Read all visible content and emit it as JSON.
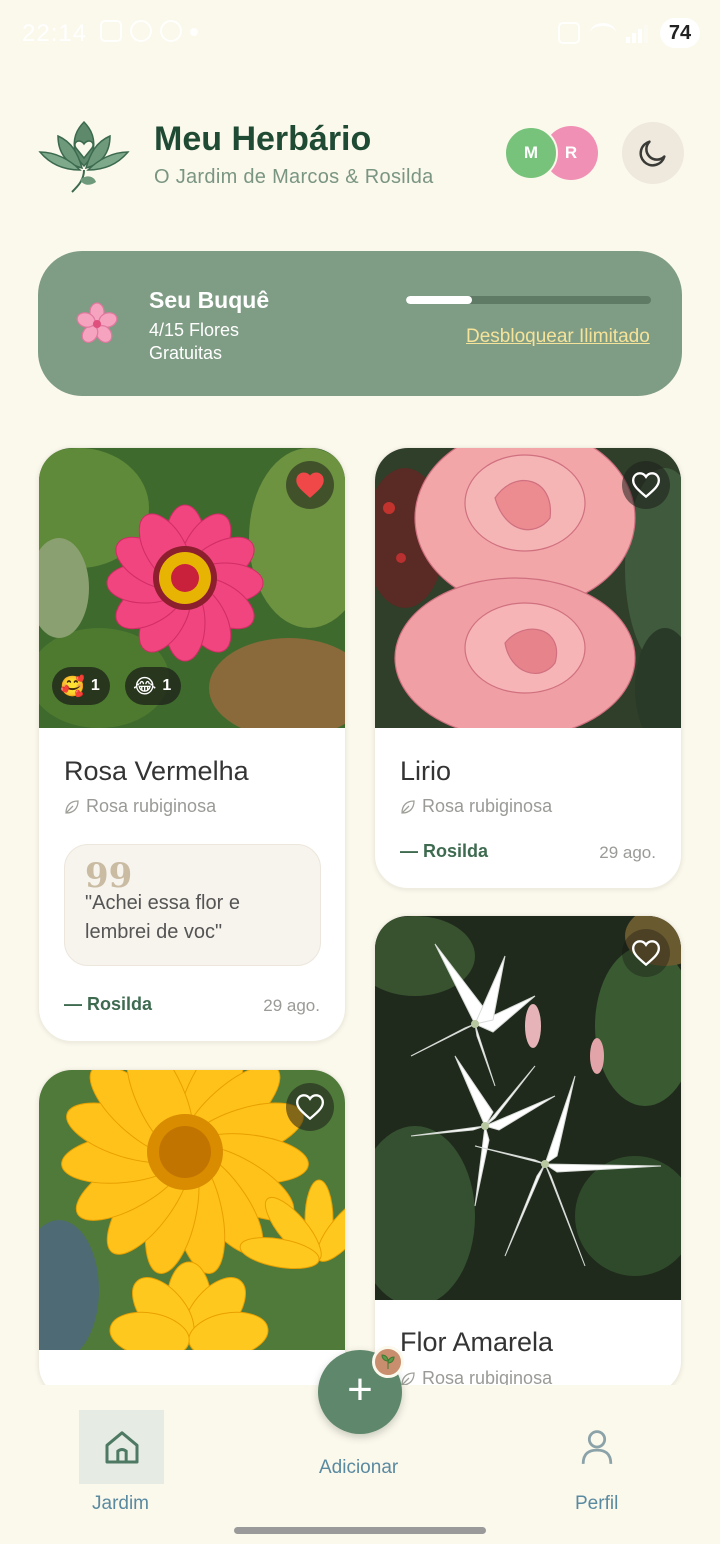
{
  "status_bar": {
    "time": "22:14",
    "battery": "74"
  },
  "header": {
    "title": "Meu Herbário",
    "subtitle": "O Jardim de Marcos & Rosilda",
    "avatars": [
      "M",
      "R"
    ]
  },
  "bouquet": {
    "title": "Seu Buquê",
    "count": "4/15 Flores Gratuitas",
    "progress": 0.27,
    "unlock_label": "Desbloquear Ilimitado"
  },
  "cards": [
    {
      "name": "Rosa Vermelha",
      "scientific": "Rosa rubiginosa",
      "favorited": true,
      "reactions": [
        {
          "emoji": "🥰",
          "count": "1"
        },
        {
          "emoji": "😂",
          "count": "1"
        }
      ],
      "quote_mark": "99",
      "quote": "\"Achei essa flor e lembrei de voc\"",
      "author": "— Rosilda",
      "date": "29 ago."
    },
    {
      "name": "Lirio",
      "scientific": "Rosa rubiginosa",
      "favorited": false,
      "author": "— Rosilda",
      "date": "29 ago."
    },
    {
      "name": "",
      "favorited": false
    },
    {
      "name": "Flor Amarela",
      "scientific": "Rosa rubiginosa",
      "favorited": false
    }
  ],
  "nav": {
    "home_label": "Jardim",
    "add_label": "Adicionar",
    "profile_label": "Perfil",
    "add_symbol": "+"
  },
  "colors": {
    "background": "#fbf8ec",
    "primary": "#5e876c",
    "banner": "#7f9c84",
    "heart_active": "#f04848",
    "link": "#f6e39a"
  },
  "icons": [
    "lotus-logo-icon",
    "moon-icon",
    "sakura-icon",
    "heart-icon",
    "leaf-icon",
    "quote-icon",
    "home-icon",
    "plus-icon",
    "person-icon"
  ]
}
